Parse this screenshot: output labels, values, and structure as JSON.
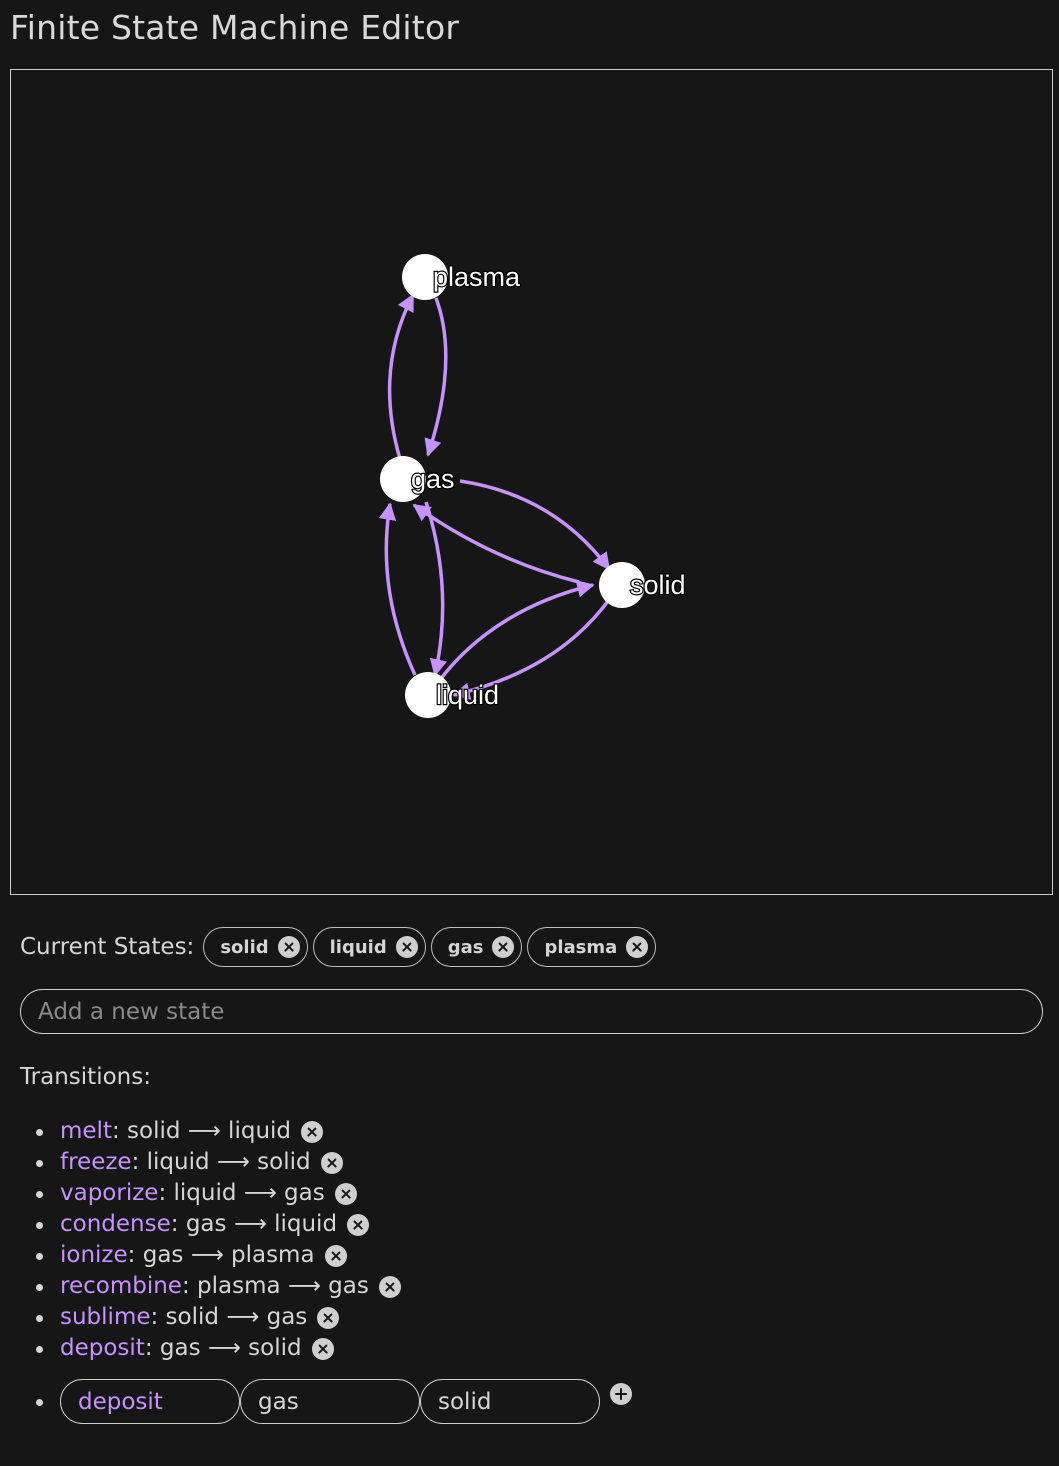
{
  "app": {
    "title": "Finite State Machine Editor"
  },
  "colors": {
    "background": "#161616",
    "edge": "#c792ff",
    "node": "#ffffff",
    "transition_name": "#c792ff"
  },
  "graph": {
    "nodes": [
      {
        "id": "plasma",
        "label": "plasma"
      },
      {
        "id": "gas",
        "label": "gas"
      },
      {
        "id": "solid",
        "label": "solid"
      },
      {
        "id": "liquid",
        "label": "liquid"
      }
    ]
  },
  "states": {
    "label": "Current States:",
    "items": [
      "solid",
      "liquid",
      "gas",
      "plasma"
    ],
    "new_state_placeholder": "Add a new state"
  },
  "transitions": {
    "label": "Transitions:",
    "items": [
      {
        "name": "melt",
        "rest": ": solid ⟶ liquid"
      },
      {
        "name": "freeze",
        "rest": ": liquid ⟶ solid"
      },
      {
        "name": "vaporize",
        "rest": ": liquid ⟶ gas"
      },
      {
        "name": "condense",
        "rest": ": gas ⟶ liquid"
      },
      {
        "name": "ionize",
        "rest": ": gas ⟶ plasma"
      },
      {
        "name": "recombine",
        "rest": ": plasma ⟶ gas"
      },
      {
        "name": "sublime",
        "rest": ": solid ⟶ gas"
      },
      {
        "name": "deposit",
        "rest": ": gas ⟶ solid"
      }
    ],
    "new": {
      "name": "deposit",
      "from": "gas",
      "to": "solid"
    }
  }
}
